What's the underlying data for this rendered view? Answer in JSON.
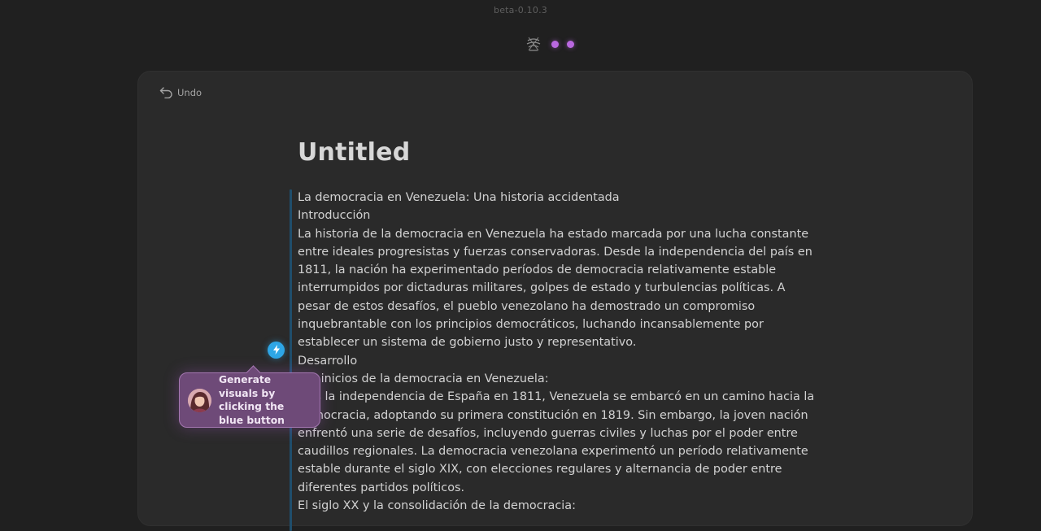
{
  "app": {
    "version": "beta-0.10.3",
    "status_indicator_color": "#b968e0",
    "accent_blue": "#2ea6e6"
  },
  "toolbar": {
    "undo_label": "Undo",
    "undo_icon": "undo-arrow-icon"
  },
  "document": {
    "title": "Untitled",
    "paragraphs": [
      "La democracia en Venezuela: Una historia accidentada",
      "Introducción",
      "La historia de la democracia en Venezuela ha estado marcada por una lucha constante entre ideales progresistas y fuerzas conservadoras. Desde la independencia del país en 1811, la nación ha experimentado períodos de democracia relativamente estable interrumpidos por dictaduras militares, golpes de estado y turbulencias políticas. A pesar de estos desafíos, el pueblo venezolano ha demostrado un compromiso inquebrantable con los principios democráticos, luchando incansablemente por establecer un sistema de gobierno justo y representativo.",
      "Desarrollo",
      "Los inicios de la democracia en Venezuela:",
      "Tras la independencia de España en 1811, Venezuela se embarcó en un camino hacia la democracia, adoptando su primera constitución en 1819. Sin embargo, la joven nación enfrentó una serie de desafíos, incluyendo guerras civiles y luchas por el poder entre caudillos regionales. La democracia venezolana experimentó un período relativamente estable durante el siglo XIX, con elecciones regulares y alternancia de poder entre diferentes partidos políticos.",
      "El siglo XX y la consolidación de la democracia:"
    ]
  },
  "tooltip": {
    "text": "Generate visuals by clicking the blue button"
  }
}
